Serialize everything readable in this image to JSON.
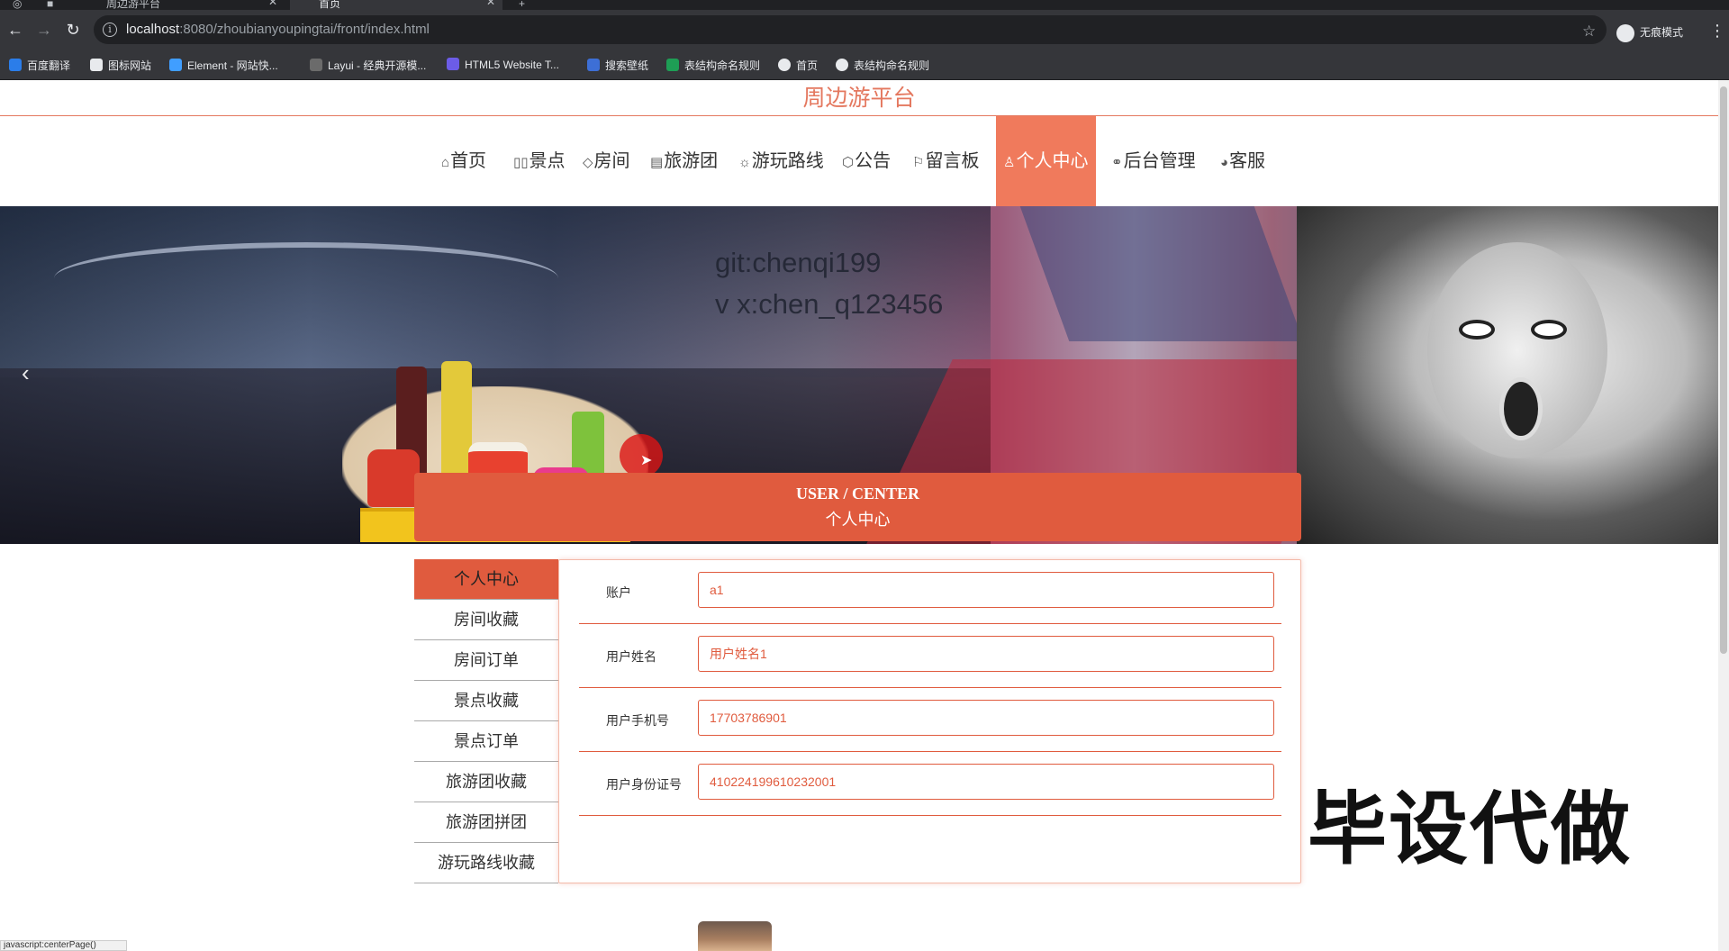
{
  "browser": {
    "tabs": [
      {
        "label": "周边游平台",
        "favicon": "vue-icon"
      },
      {
        "label": "首页",
        "favicon": "globe-icon"
      }
    ],
    "url_host": "localhost",
    "url_rest": ":8080/zhoubianyoupingtai/front/index.html",
    "incognito_label": "无痕模式",
    "bookmarks": [
      "百度翻译",
      "图标网站",
      "Element - 网站快...",
      "Layui - 经典开源模...",
      "HTML5 Website T...",
      "搜索壁纸",
      "表结构命名规则",
      "首页",
      "表结构命名规则"
    ]
  },
  "site": {
    "title": "周边游平台",
    "nav": [
      {
        "label": "首页",
        "icon": "home-icon"
      },
      {
        "label": "景点",
        "icon": "book-icon"
      },
      {
        "label": "房间",
        "icon": "tag-icon"
      },
      {
        "label": "旅游团",
        "icon": "calendar-icon"
      },
      {
        "label": "游玩路线",
        "icon": "gear-icon"
      },
      {
        "label": "公告",
        "icon": "cube-icon"
      },
      {
        "label": "留言板",
        "icon": "flag-icon"
      },
      {
        "label": "个人中心",
        "icon": "user-icon",
        "active": true
      },
      {
        "label": "后台管理",
        "icon": "link-icon"
      },
      {
        "label": "客服",
        "icon": "chat-icon"
      }
    ]
  },
  "banner": {
    "watermark_line1": "git:chenqi199",
    "watermark_line2": "v x:chen_q123456",
    "prev_arrow": "‹",
    "active_slide": 1,
    "slide_count": 3
  },
  "section": {
    "title_en": "USER / CENTER",
    "title_cn": "个人中心"
  },
  "sidebar": {
    "items": [
      "个人中心",
      "房间收藏",
      "房间订单",
      "景点收藏",
      "景点订单",
      "旅游团收藏",
      "旅游团拼团",
      "游玩路线收藏"
    ],
    "active_index": 0
  },
  "form": {
    "fields": [
      {
        "label": "账户",
        "value": "a1"
      },
      {
        "label": "用户姓名",
        "value": "用户姓名1"
      },
      {
        "label": "用户手机号",
        "value": "17703786901"
      },
      {
        "label": "用户身份证号",
        "value": "410224199610232001"
      }
    ]
  },
  "promo_text": "毕设代做",
  "status_text": "javascript:centerPage()",
  "colors": {
    "accent": "#e05b3e",
    "nav_active": "#f07a5c",
    "title": "#e4785f"
  }
}
